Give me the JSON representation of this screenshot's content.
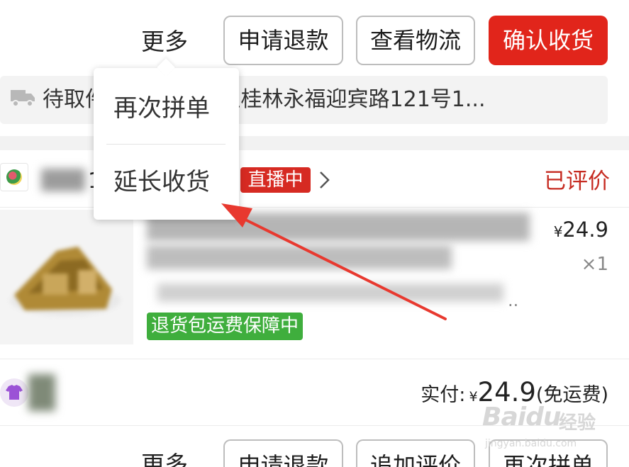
{
  "actions": {
    "more": "更多",
    "refund": "申请退款",
    "logistics": "查看物流",
    "confirm": "确认收货"
  },
  "logistics_bar": {
    "text": "待取件  快件已暂存至桂林永福迎宾路121号1..."
  },
  "popup_menu": {
    "items": [
      "再次拼单",
      "延长收货"
    ]
  },
  "order": {
    "shop_name_visible": "1",
    "live_badge": "直播中",
    "status": "已评价",
    "price_symbol": "¥",
    "price": "24.9",
    "quantity": "×1",
    "guarantee": "退货包运费保障中",
    "spec_ellipsis": "..",
    "paid_label": "实付:",
    "paid_symbol": "¥",
    "paid_amount": "24.9",
    "paid_note": "(免运费)"
  },
  "bottom_actions": {
    "more": "更多",
    "refund": "申请退款",
    "add_review": "追加评价",
    "reorder": "再次拼单"
  },
  "watermark": {
    "brand": "Baidu",
    "text": "经验",
    "url": "jingyan.baidu.com"
  },
  "colors": {
    "primary_red": "#e1251b",
    "status_red": "#c62b21",
    "guarantee_green": "#3fae3d",
    "annotation_arrow": "#e8392f"
  }
}
